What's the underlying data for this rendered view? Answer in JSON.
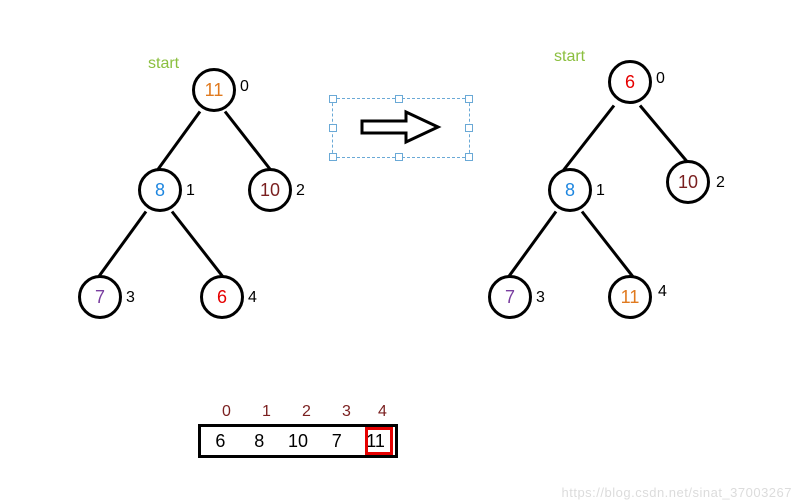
{
  "labels": {
    "start": "start"
  },
  "left_tree": {
    "nodes": {
      "n0": {
        "value": "11",
        "index": "0",
        "color": "#e07a1f"
      },
      "n1": {
        "value": "8",
        "index": "1",
        "color": "#1f87e0"
      },
      "n2": {
        "value": "10",
        "index": "2",
        "color": "#7a1f1f"
      },
      "n3": {
        "value": "7",
        "index": "3",
        "color": "#7a3fa0"
      },
      "n4": {
        "value": "6",
        "index": "4",
        "color": "#e60000"
      }
    }
  },
  "right_tree": {
    "nodes": {
      "n0": {
        "value": "6",
        "index": "0",
        "color": "#e60000"
      },
      "n1": {
        "value": "8",
        "index": "1",
        "color": "#1f87e0"
      },
      "n2": {
        "value": "10",
        "index": "2",
        "color": "#7a1f1f"
      },
      "n3": {
        "value": "7",
        "index": "3",
        "color": "#7a3fa0"
      },
      "n4": {
        "value": "11",
        "index": "4",
        "color": "#e07a1f"
      }
    }
  },
  "array": {
    "indices": [
      "0",
      "1",
      "2",
      "3",
      "4"
    ],
    "values": [
      "6",
      "8",
      "10",
      "7",
      "11"
    ],
    "highlight_index": 4
  },
  "watermark": "https://blog.csdn.net/sinat_37003267",
  "chart_data": {
    "type": "diagram",
    "description": "Heap sort step: swap root (11) with last leaf (6), array after step shown with last cell highlighted.",
    "before_tree_level_order": [
      11,
      8,
      10,
      7,
      6
    ],
    "after_tree_level_order": [
      6,
      8,
      10,
      7,
      11
    ],
    "array_state": [
      6,
      8,
      10,
      7,
      11
    ],
    "highlighted_array_index": 4
  }
}
